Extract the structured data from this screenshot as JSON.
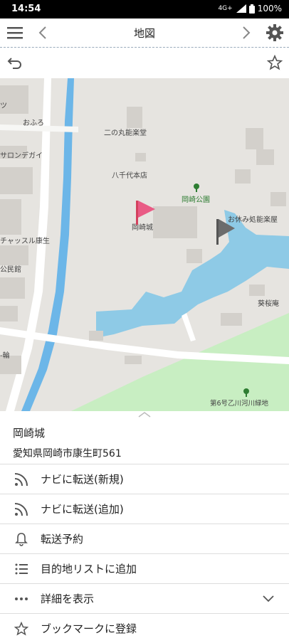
{
  "status_bar": {
    "time": "14:54",
    "network": "4G+",
    "battery": "100%"
  },
  "header": {
    "title": "地図"
  },
  "map": {
    "labels": {
      "ofuro": "おふろ",
      "ninomaru": "二の丸能楽堂",
      "sarondagai": "サロンデガイ",
      "hatchoten": "八千代本店",
      "okazaki_park": "岡崎公園",
      "okazaki_castle": "岡崎城",
      "oyasumi": "お休み処能楽屋",
      "chassuru": "チャッスル康生",
      "kouminkan": "公民館",
      "aoian": "葵桜庵",
      "riverside_park": "第6号乙川河川緑地",
      "left_edge_1": "ツ",
      "left_edge_2": "-輪"
    },
    "colors": {
      "water": "#8ecae6",
      "river": "#6cb6e8",
      "park": "#c8eec2",
      "land": "#e6e4e0",
      "building": "#d3d0cb"
    }
  },
  "place": {
    "name": "岡崎城",
    "address": "愛知県岡崎市康生町561"
  },
  "menu": [
    {
      "label": "ナビに転送(新規)",
      "icon": "rss-icon"
    },
    {
      "label": "ナビに転送(追加)",
      "icon": "rss-icon"
    },
    {
      "label": "転送予約",
      "icon": "bell-icon"
    },
    {
      "label": "目的地リストに追加",
      "icon": "list-icon"
    },
    {
      "label": "詳細を表示",
      "icon": "more-icon"
    },
    {
      "label": "ブックマークに登録",
      "icon": "star-outline-icon"
    }
  ]
}
